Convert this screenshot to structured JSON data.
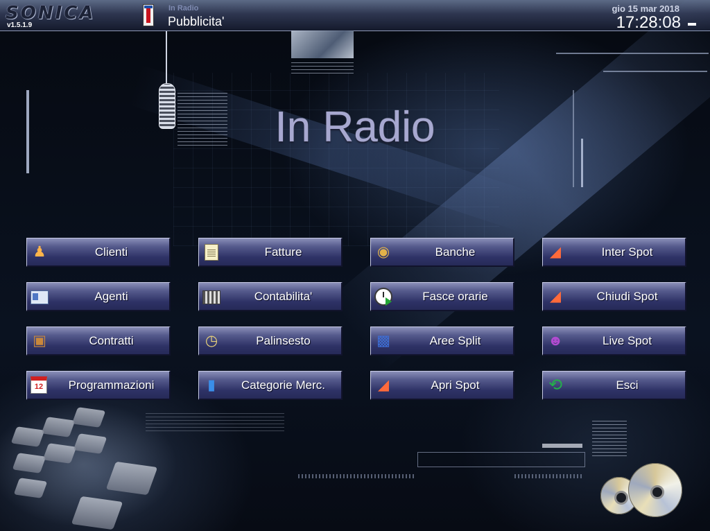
{
  "app": {
    "logo": "SONICA",
    "version": "v1.5.1.9"
  },
  "header": {
    "section_small": "In Radio",
    "section_main": "Pubblicita'",
    "date": "gio 15 mar 2018",
    "time": "17:28:08"
  },
  "main": {
    "title": "In Radio"
  },
  "buttons": [
    {
      "label": "Clienti",
      "icon": "users-icon"
    },
    {
      "label": "Fatture",
      "icon": "invoice-icon"
    },
    {
      "label": "Banche",
      "icon": "money-bag-icon"
    },
    {
      "label": "Inter Spot",
      "icon": "megaphone-icon"
    },
    {
      "label": "Agenti",
      "icon": "id-card-icon"
    },
    {
      "label": "Contabilita'",
      "icon": "calculator-icon"
    },
    {
      "label": "Fasce orarie",
      "icon": "clock-icon"
    },
    {
      "label": "Chiudi Spot",
      "icon": "megaphone-icon"
    },
    {
      "label": "Contratti",
      "icon": "package-icon"
    },
    {
      "label": "Palinsesto",
      "icon": "schedule-icon"
    },
    {
      "label": "Aree Split",
      "icon": "hierarchy-icon"
    },
    {
      "label": "Live Spot",
      "icon": "live-icon"
    },
    {
      "label": "Programmazioni",
      "icon": "calendar-icon",
      "icon_text": "12"
    },
    {
      "label": "Categorie Merc.",
      "icon": "book-icon"
    },
    {
      "label": "Apri Spot",
      "icon": "megaphone-icon"
    },
    {
      "label": "Esci",
      "icon": "exit-arrow-icon"
    }
  ],
  "colors": {
    "button_top": "#8a8fb8",
    "button_bottom": "#262a58",
    "title_text": "#a7a8d0"
  }
}
